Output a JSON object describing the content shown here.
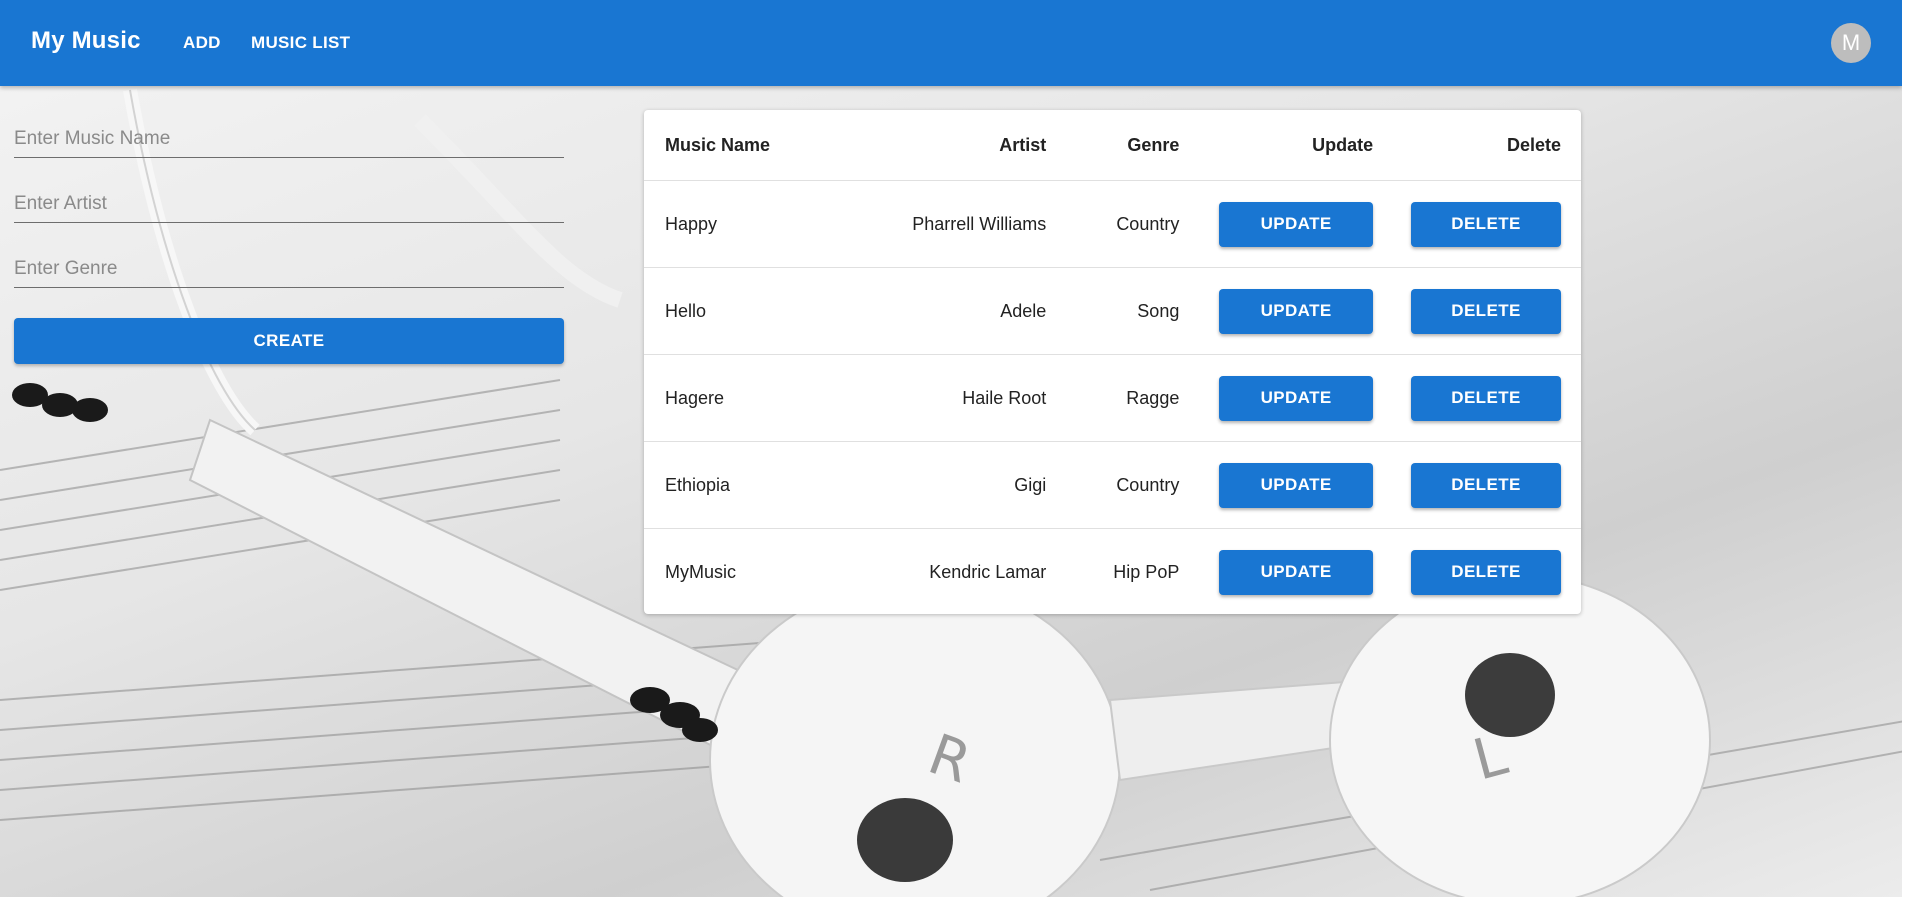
{
  "appbar": {
    "brand": "My Music",
    "nav": {
      "add": "ADD",
      "music_list": "MUSIC LIST"
    },
    "avatar_letter": "M"
  },
  "form": {
    "music_name_placeholder": "Enter Music Name",
    "artist_placeholder": "Enter Artist",
    "genre_placeholder": "Enter Genre",
    "create_label": "CREATE"
  },
  "table": {
    "headers": {
      "name": "Music Name",
      "artist": "Artist",
      "genre": "Genre",
      "update": "Update",
      "delete": "Delete"
    },
    "update_label": "UPDATE",
    "delete_label": "DELETE",
    "rows": [
      {
        "name": "Happy",
        "artist": "Pharrell Williams",
        "genre": "Country"
      },
      {
        "name": "Hello",
        "artist": "Adele",
        "genre": "Song"
      },
      {
        "name": "Hagere",
        "artist": "Haile Root",
        "genre": "Ragge"
      },
      {
        "name": "Ethiopia",
        "artist": "Gigi",
        "genre": "Country"
      },
      {
        "name": "MyMusic",
        "artist": "Kendric Lamar",
        "genre": "Hip PoP"
      }
    ]
  },
  "colors": {
    "primary": "#1976d2",
    "avatar": "#bdbdbd"
  },
  "icons": {
    "background": "headphones-on-sheet-music-photo"
  }
}
